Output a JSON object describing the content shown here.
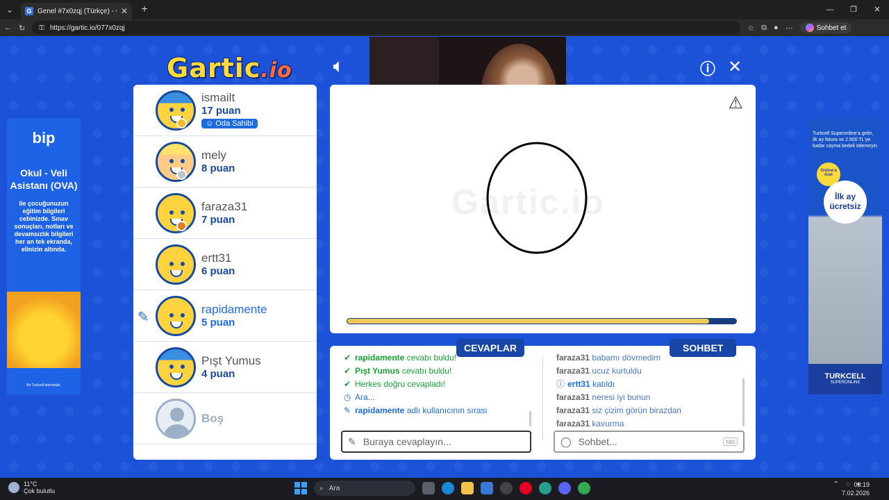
{
  "browser": {
    "tab_title": "Genel #7x0zqj (Türkçe) - Gartic.io",
    "url": "https://gartic.io/077x0zqj",
    "chat_button": "Sohbet et"
  },
  "game": {
    "logo_main": "Gartic",
    "logo_suffix": ".io",
    "watermark": "Gartic.io",
    "timer_fraction": 0.93,
    "players": [
      {
        "name": "ismailt",
        "score": "17 puan",
        "badge": "Oda Sahibi",
        "dot": "#f6b823"
      },
      {
        "name": "mely",
        "score": "8 puan",
        "dot": "#c4c4c4"
      },
      {
        "name": "faraza31",
        "score": "7 puan",
        "dot": "#e07d1f"
      },
      {
        "name": "ertt31",
        "score": "6 puan"
      },
      {
        "name": "rapidamente",
        "score": "5 puan",
        "drawing": true
      },
      {
        "name": "Pışt Yumus",
        "score": "4 puan"
      },
      {
        "name": "Boş"
      }
    ],
    "answers_title": "CEVAPLAR",
    "chat_title": "SOHBET",
    "answers": [
      {
        "user": "rapidamente",
        "text": "cevabı buldu!"
      },
      {
        "user": "Pışt Yumus",
        "text": "cevabı buldu!"
      },
      {
        "text": "Herkes doğru cevapladı!"
      },
      {
        "text": "Ara..."
      },
      {
        "user": "rapidamente",
        "text": "adlı kullanıcının sırası"
      }
    ],
    "chat": [
      {
        "user": "faraza31",
        "text": "babamı dövmedim"
      },
      {
        "user": "faraza31",
        "text": "ucuz kurtuldu"
      },
      {
        "user": "ertt31",
        "text": "katıldı"
      },
      {
        "user": "faraza31",
        "text": "neresi iyi bunun"
      },
      {
        "user": "faraza31",
        "text": "siz çizim görün birazdan"
      },
      {
        "user": "faraza31",
        "text": "kavurma"
      }
    ],
    "answer_placeholder": "Buraya cevaplayın...",
    "chat_placeholder": "Sohbet...",
    "tab_hint": "tab"
  },
  "ads": {
    "left": {
      "brand": "bip",
      "headline": "Okul - Veli Asistanı (OVA)",
      "body": "ile çocuğunuzun eğitim bilgileri cebinizde. Sınav sonuçları, notları ve devamsızlık bilgileri her an tek ekranda, elinizin altında.",
      "footer": "Bir Turkcell teknolojisi."
    },
    "right": {
      "promo": "Turkcell Superonline'a gelin, ilk ay fatura ve 2.500 TL'ye kadar cayma bedeli ödemeyin",
      "small_badge": "Online'a özel",
      "badge": "İlk ay ücretsiz",
      "brand": "TURKCELL",
      "brand_sub": "SUPERONLINE"
    }
  },
  "taskbar": {
    "temp": "11°C",
    "weather": "Çok bulutlu",
    "search": "Ara",
    "time": "03:19",
    "date": "7.02.2026"
  }
}
